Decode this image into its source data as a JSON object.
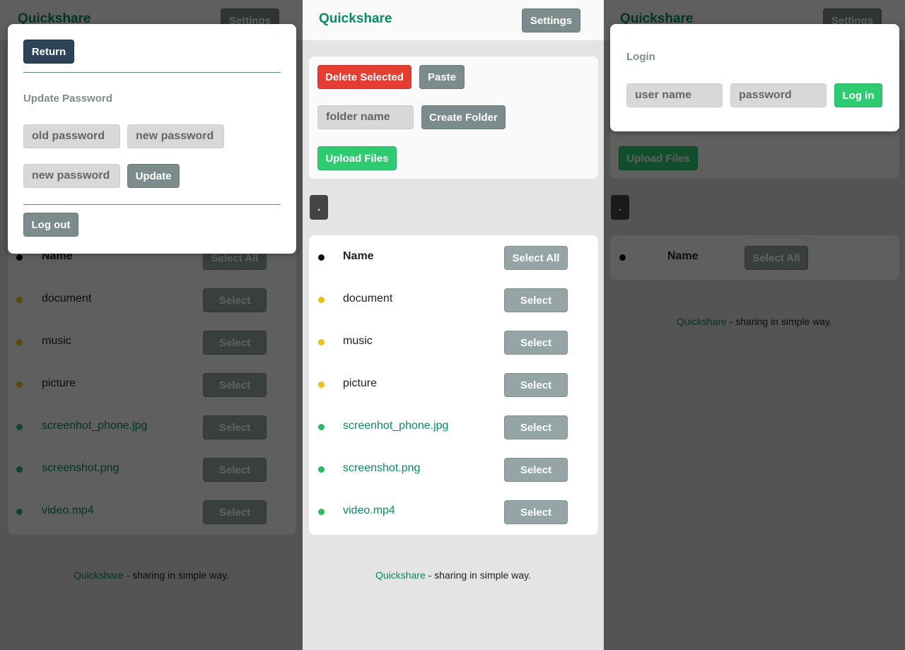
{
  "app": {
    "brand": "Quickshare",
    "settings_label": "Settings"
  },
  "toolbar": {
    "delete_selected": "Delete Selected",
    "paste": "Paste",
    "folder_placeholder": "folder name",
    "create_folder": "Create Folder",
    "upload_files": "Upload Files"
  },
  "path": {
    "current": "."
  },
  "list": {
    "header": {
      "name": "Name",
      "select_all": "Select All"
    },
    "select_label": "Select",
    "items": [
      {
        "name": "document",
        "kind": "folder"
      },
      {
        "name": "music",
        "kind": "folder"
      },
      {
        "name": "picture",
        "kind": "folder"
      },
      {
        "name": "screenhot_phone.jpg",
        "kind": "file"
      },
      {
        "name": "screenshot.png",
        "kind": "file"
      },
      {
        "name": "video.mp4",
        "kind": "file"
      }
    ]
  },
  "footer": {
    "brand": "Quickshare",
    "tagline": " - sharing in simple way."
  },
  "settings_modal": {
    "return": "Return",
    "section_title": "Update Password",
    "old_password": "old password",
    "new_password": "new password",
    "new_password_repeat": "new password",
    "update": "Update",
    "logout": "Log out"
  },
  "login_modal": {
    "title": "Login",
    "user_placeholder": "user name",
    "password_placeholder": "password",
    "login": "Log in"
  },
  "colors": {
    "brand": "#0a8a63",
    "danger": "#e53d32",
    "success": "#2ecc71",
    "neutral": "#7c8b8b",
    "navy": "#2d4358",
    "folder_dot": "#e6c21a",
    "file_dot": "#2bb868"
  }
}
